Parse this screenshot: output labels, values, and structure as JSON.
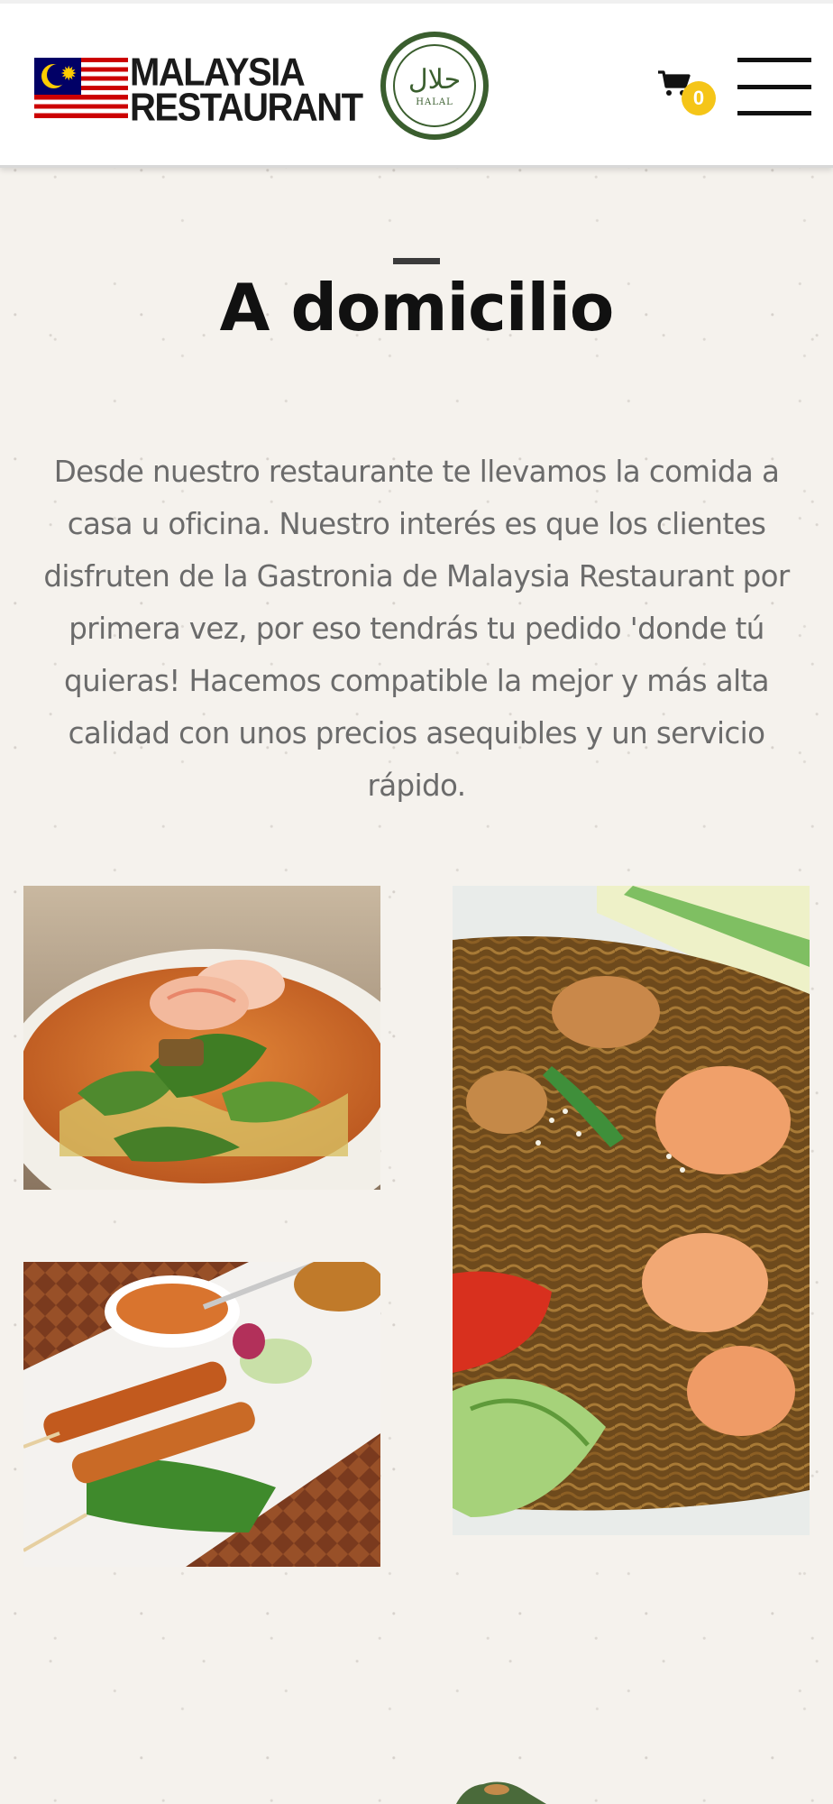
{
  "header": {
    "logo_line1": "MALAYSIA",
    "logo_line2": "RESTAURANT",
    "halal_arabic": "حلال",
    "halal_latin": "HALAL",
    "cart_count": "0",
    "cart_icon": "shopping-cart-icon",
    "menu_icon": "hamburger-menu-icon"
  },
  "main": {
    "title": "A domicilio",
    "intro": "Desde nuestro restaurante te llevamos la comida a casa u oficina. Nuestro interés es que los clientes disfruten de la Gastronia de Malaysia Restaurant por primera vez, por eso tendrás tu pedido 'donde tú quieras! Hacemos compatible la mejor y más alta calidad con unos precios asequibles y un servicio rápido."
  },
  "colors": {
    "background": "#f5f2ed",
    "badge": "#f5c518",
    "halal_green": "#3a5e2e",
    "text_body": "#6b6b6b"
  }
}
